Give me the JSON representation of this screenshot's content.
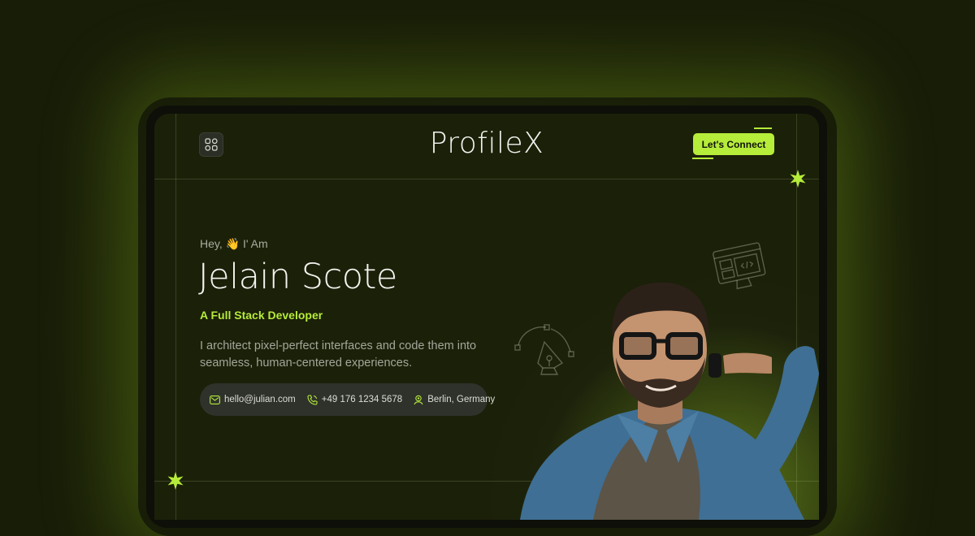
{
  "header": {
    "brand": "ProfileX",
    "cta_label": "Let's Connect"
  },
  "hero": {
    "greeting": "Hey, 👋 I' Am",
    "name": "Jelain Scote",
    "role": "A Full Stack Developer",
    "bio": "I architect pixel-perfect interfaces and code them into seamless, human-centered experiences."
  },
  "contact": {
    "email": "hello@julian.com",
    "phone": "+49 176 1234 5678",
    "location": "Berlin, Germany"
  },
  "icons": {
    "menu": "grid-icon",
    "email": "mail-icon",
    "phone": "phone-icon",
    "location": "user-pin-icon",
    "decor_1": "pen-tool-icon",
    "decor_2": "web-design-monitor-icon",
    "sparkle": "sparkle-icon"
  },
  "colors": {
    "accent": "#b6ec3a",
    "background": "#1b2009"
  }
}
